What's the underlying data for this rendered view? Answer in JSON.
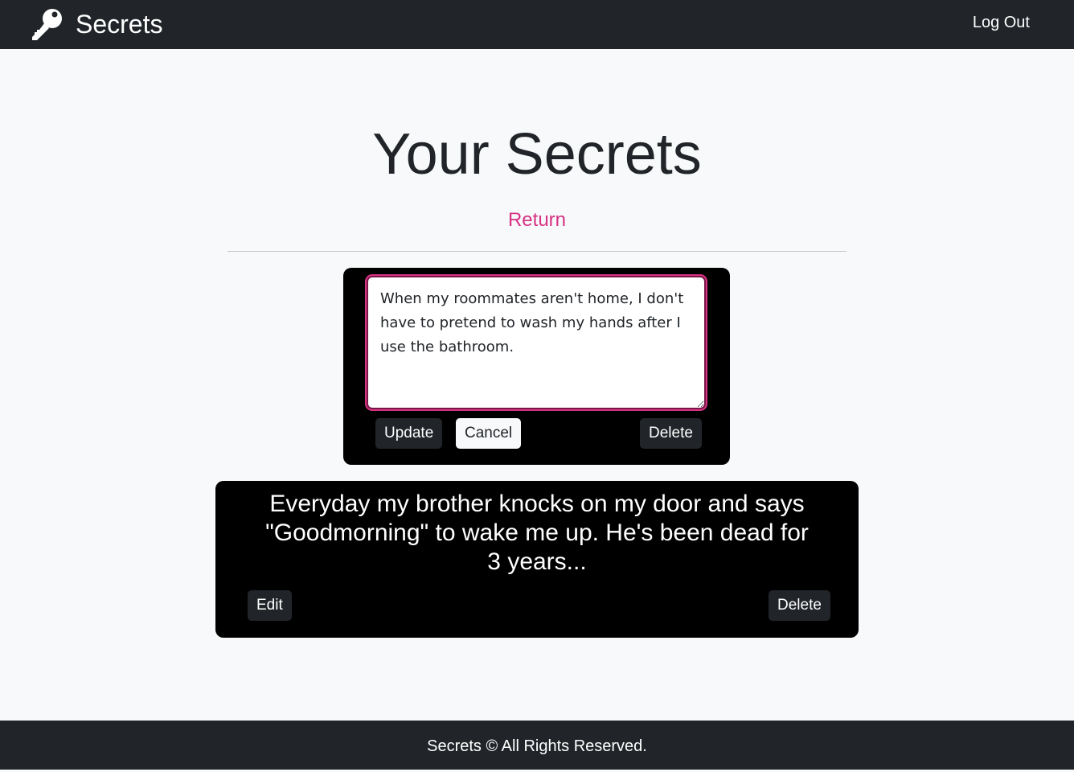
{
  "nav": {
    "brand": "Secrets",
    "logout": "Log Out"
  },
  "page": {
    "title": "Your Secrets",
    "return": "Return"
  },
  "edit_card": {
    "text": "When my roommates aren't home, I don't have to pretend to wash my hands after I use the bathroom.",
    "update": "Update",
    "cancel": "Cancel",
    "delete": "Delete"
  },
  "secret_card": {
    "text": "Everyday my brother knocks on my door and says \"Goodmorning\" to wake me up. He's been dead for 3 years...",
    "edit": "Edit",
    "delete": "Delete"
  },
  "footer": {
    "text": "Secrets © All Rights Reserved."
  },
  "colors": {
    "navbar": "#212529",
    "accent": "#d63384",
    "card": "#000000",
    "background": "#f8f9fa"
  },
  "icons": {
    "brand": "key-icon"
  }
}
